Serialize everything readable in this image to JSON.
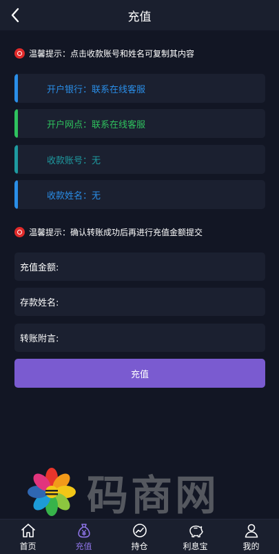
{
  "header": {
    "title": "充值"
  },
  "tips": [
    "温馨提示：点击收款账号和姓名可复制其内容",
    "温馨提示：确认转账成功后再进行充值金额提交"
  ],
  "info_cards": [
    {
      "text": "开户银行：联系在线客服",
      "color": "#2a8ee8"
    },
    {
      "text": "开户网点：联系在线客服",
      "color": "#2fc25e"
    },
    {
      "text": "收款账号：无",
      "color": "#1e9aa0"
    },
    {
      "text": "收款姓名：无",
      "color": "#2a8ee8"
    }
  ],
  "form": {
    "amount_label": "充值金额:",
    "name_label": "存款姓名:",
    "note_label": "转账附言:",
    "submit_label": "充值"
  },
  "watermark": {
    "text": "码商网"
  },
  "tabs": [
    {
      "label": "首页",
      "icon": "home-icon"
    },
    {
      "label": "充值",
      "icon": "money-bag-icon",
      "active": true
    },
    {
      "label": "持仓",
      "icon": "chart-icon"
    },
    {
      "label": "利息宝",
      "icon": "piggy-bank-icon"
    },
    {
      "label": "我的",
      "icon": "user-icon"
    }
  ],
  "colors": {
    "accent": "#7a5bd0",
    "active_tab": "#8d74e6",
    "background": "#121624",
    "card": "#1b2030"
  }
}
